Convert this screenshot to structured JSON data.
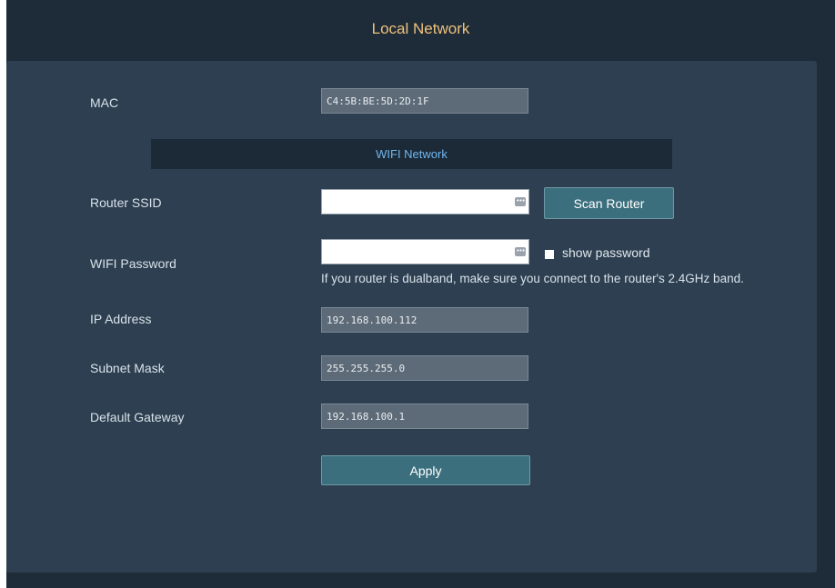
{
  "header": {
    "title": "Local Network"
  },
  "form": {
    "mac": {
      "label": "MAC",
      "value": "C4:5B:BE:5D:2D:1F"
    },
    "section_title": "WIFI Network",
    "router_ssid": {
      "label": "Router SSID",
      "value": ""
    },
    "scan_button": "Scan Router",
    "wifi_password": {
      "label": "WIFI Password",
      "value": ""
    },
    "show_password_label": "show password",
    "show_password_checked": false,
    "hint": "If you router is dualband, make sure you connect to the router's 2.4GHz band.",
    "ip_address": {
      "label": "IP Address",
      "value": "192.168.100.112"
    },
    "subnet_mask": {
      "label": "Subnet Mask",
      "value": "255.255.255.0"
    },
    "default_gateway": {
      "label": "Default Gateway",
      "value": "192.168.100.1"
    },
    "apply_button": "Apply"
  },
  "icons": {
    "field_icon": "password-manager-key-icon",
    "field_icon_glyph": "•••"
  },
  "colors": {
    "background": "#1e2b38",
    "panel": "#2d3f50",
    "title": "#f0c27a",
    "section_title": "#6fb6ef",
    "button": "#3c6f7e"
  }
}
